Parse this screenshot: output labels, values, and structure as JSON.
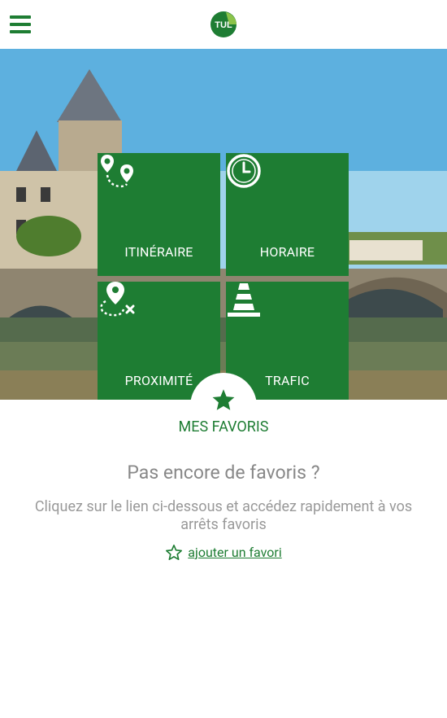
{
  "header": {
    "logo_text": "TUL",
    "menu_icon": "hamburger-menu-icon"
  },
  "tiles": [
    {
      "label": "ITINÉRAIRE",
      "icon": "route-icon"
    },
    {
      "label": "HORAIRE",
      "icon": "clock-icon"
    },
    {
      "label": "PROXIMITÉ",
      "icon": "nearby-stop-icon"
    },
    {
      "label": "TRAFIC",
      "icon": "traffic-cone-icon"
    }
  ],
  "favorites": {
    "title": "MES FAVORIS",
    "empty_title": "Pas encore de favoris ?",
    "empty_description": "Cliquez sur le lien ci-dessous et accédez rapidement à vos arrêts favoris",
    "add_label": "ajouter un favori"
  },
  "colors": {
    "brand_green": "#1e7d33",
    "text_grey": "#888888",
    "background": "#ffffff"
  }
}
